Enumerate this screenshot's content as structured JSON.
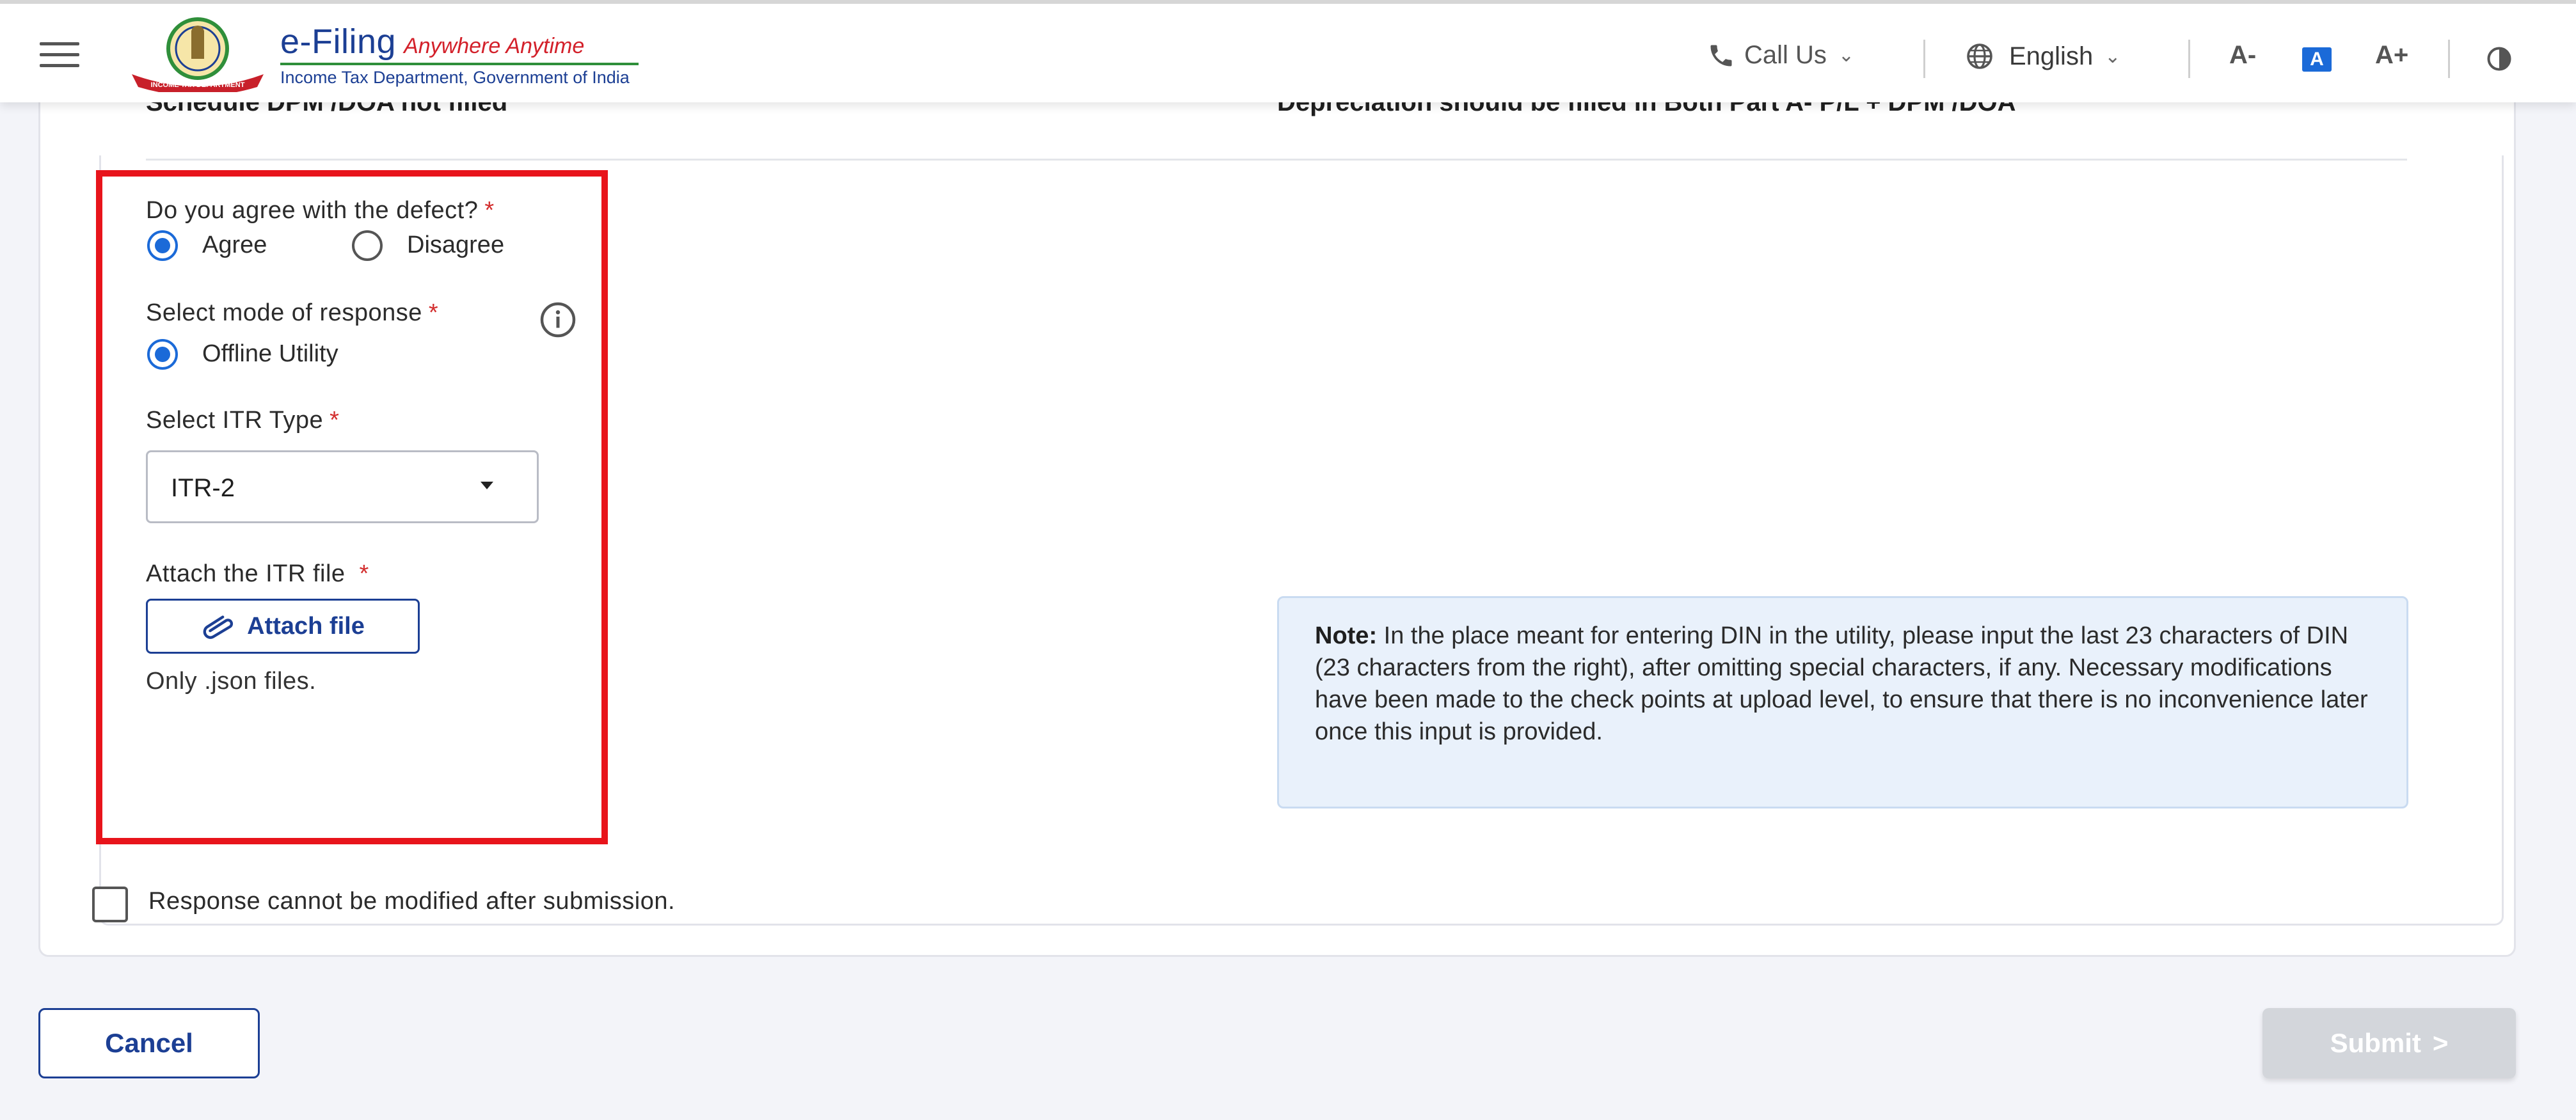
{
  "header": {
    "brand_main": "e-Filing",
    "brand_tagline": "Anywhere Anytime",
    "brand_subtitle": "Income Tax Department, Government of India",
    "logo_text": "INCOME TAX DEPARTMENT",
    "call_us": "Call Us",
    "language": "English",
    "font_decrease": "A-",
    "font_default": "A",
    "font_increase": "A+"
  },
  "defect_row": {
    "left_text": "Schedule DPM /DOA not filled",
    "right_text": "Depreciation should be filled in Both Part A- P/L + DPM /DOA"
  },
  "form": {
    "agree_question": "Do you agree with the defect?",
    "required_mark": "*",
    "agree_option": "Agree",
    "disagree_option": "Disagree",
    "agree_selected": "Agree",
    "mode_label": "Select mode of response",
    "mode_option": "Offline Utility",
    "itr_type_label": "Select ITR Type",
    "itr_type_value": "ITR-2",
    "attach_label": "Attach the ITR file",
    "attach_button": "Attach file",
    "attach_hint": "Only .json files."
  },
  "note": {
    "title": "Note:",
    "text": "In the place meant for entering DIN in the utility, please input the last 23 characters of DIN (23 characters from the right), after omitting special characters, if any. Necessary modifications have been made to the check points at upload level, to ensure that there is no inconvenience later once this input is provided."
  },
  "confirmation": {
    "label": "Response cannot be modified after submission.",
    "checked": false
  },
  "actions": {
    "cancel": "Cancel",
    "submit": "Submit",
    "submit_arrow": ">"
  },
  "colors": {
    "brand_blue": "#1c3f94",
    "accent_blue": "#1b6ad8",
    "highlight_red": "#e8141b",
    "required_red": "#d32f2f"
  }
}
